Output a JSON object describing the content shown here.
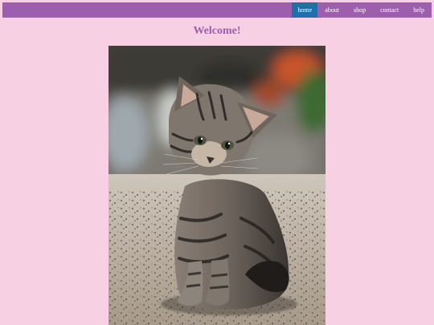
{
  "nav": {
    "items": [
      {
        "label": "home",
        "active": true
      },
      {
        "label": "about",
        "active": false
      },
      {
        "label": "shop",
        "active": false
      },
      {
        "label": "contact",
        "active": false
      },
      {
        "label": "help",
        "active": false
      }
    ]
  },
  "main": {
    "title": "Welcome!"
  },
  "colors": {
    "background": "#f8d0e4",
    "navbar": "#9b5fae",
    "nav_active": "#1f6fa8",
    "title": "#9b5fae"
  }
}
